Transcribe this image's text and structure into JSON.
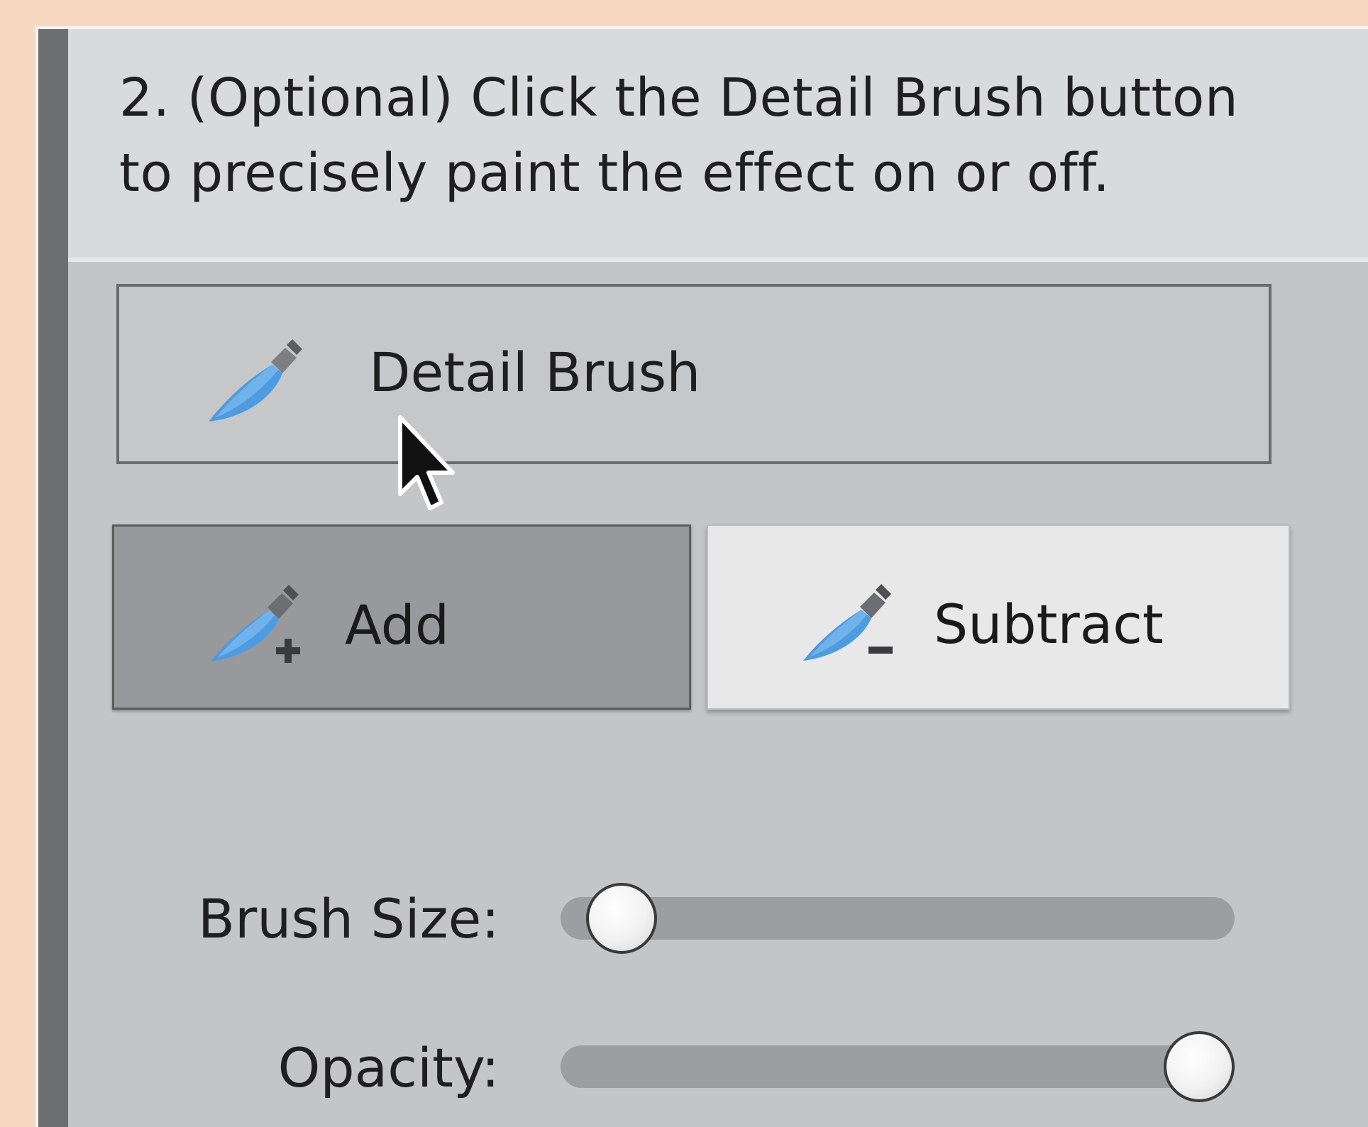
{
  "instruction": {
    "line1": "2. (Optional) Click the Detail Brush button",
    "line2": "to precisely paint the effect on or off."
  },
  "detail_brush": {
    "label": "Detail Brush",
    "icon": "brush-icon"
  },
  "mode_buttons": {
    "add": {
      "label": "Add",
      "icon": "brush-add-icon",
      "selected": true
    },
    "subtract": {
      "label": "Subtract",
      "icon": "brush-subtract-icon",
      "selected": false
    }
  },
  "sliders": {
    "brush_size": {
      "label": "Brush Size:",
      "value_fraction": 0.0
    },
    "opacity": {
      "label": "Opacity:",
      "value_fraction": 1.0
    }
  },
  "colors": {
    "accent_blue": "#4f9be0",
    "selected_button": "#97999c",
    "unselected_button": "#e8e8e8"
  }
}
